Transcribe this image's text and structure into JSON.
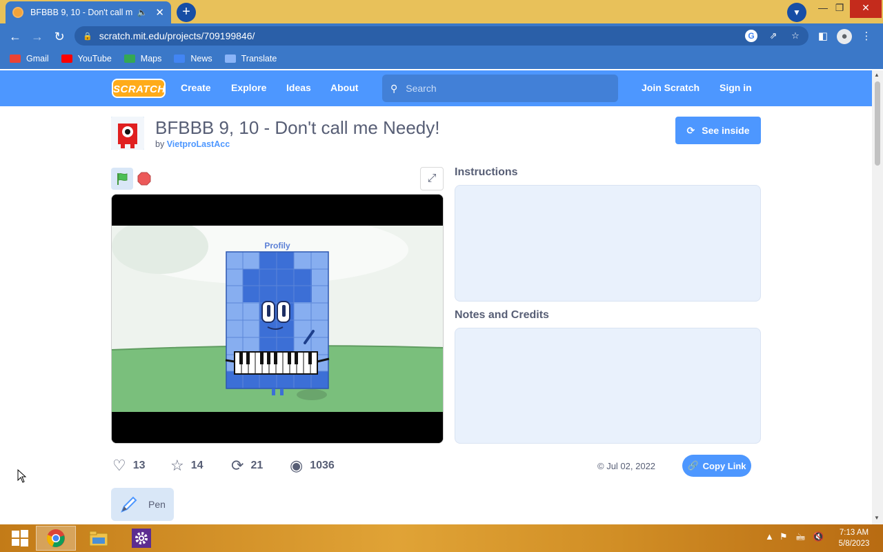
{
  "browser": {
    "tab_title": "BFBBB 9, 10 - Don't call me Needy!",
    "new_tab_label": "+",
    "url": "scratch.mit.edu/projects/709199846/",
    "bookmarks": [
      {
        "label": "Gmail",
        "icon": "gmail-icon",
        "color": "#ea4335"
      },
      {
        "label": "YouTube",
        "icon": "youtube-icon",
        "color": "#ff0000"
      },
      {
        "label": "Maps",
        "icon": "maps-icon",
        "color": "#34a853"
      },
      {
        "label": "News",
        "icon": "news-icon",
        "color": "#4285f4"
      },
      {
        "label": "Translate",
        "icon": "translate-icon",
        "color": "#4285f4"
      }
    ]
  },
  "scratch_nav": {
    "logo": "SCRATCH",
    "links": [
      "Create",
      "Explore",
      "Ideas",
      "About"
    ],
    "search_placeholder": "Search",
    "join": "Join Scratch",
    "signin": "Sign in"
  },
  "project": {
    "title": "BFBBB 9, 10 - Don't call me Needy!",
    "by_prefix": "by",
    "author": "VietproLastAcc",
    "see_inside": "See inside",
    "stage_label": "Profily",
    "instructions_heading": "Instructions",
    "notes_heading": "Notes and Credits",
    "stats": {
      "loves": "13",
      "favorites": "14",
      "remixes": "21",
      "views": "1036"
    },
    "date": "© Jul 02, 2022",
    "copy_link": "Copy Link",
    "extension_chip": "Pen"
  },
  "colors": {
    "scratch_blue": "#4d97ff",
    "chrome_blue": "#3b78c8",
    "tabstrip": "#e8c15a"
  },
  "taskbar": {
    "time": "7:13 AM",
    "date": "5/8/2023"
  }
}
